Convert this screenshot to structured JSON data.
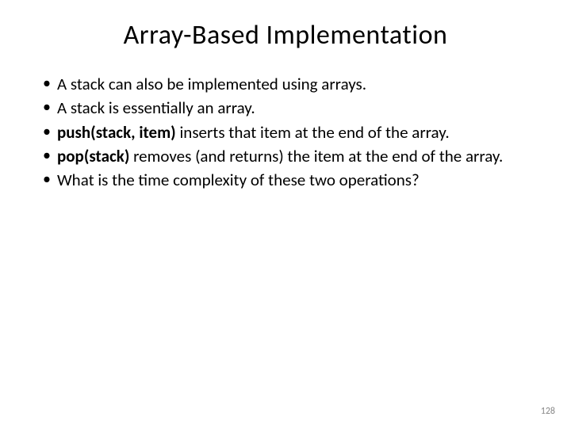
{
  "title": "Array-Based Implementation",
  "bullets": {
    "b0": "A stack can also be implemented using arrays.",
    "b1": "A stack is essentially an array.",
    "b2_bold": "push(stack, item)",
    "b2_rest": " inserts that item at the end of the array.",
    "b3_bold": "pop(stack)",
    "b3_rest": " removes (and returns) the item at the end of the array.",
    "b4": "What is the time complexity of these two operations?"
  },
  "page_number": "128"
}
